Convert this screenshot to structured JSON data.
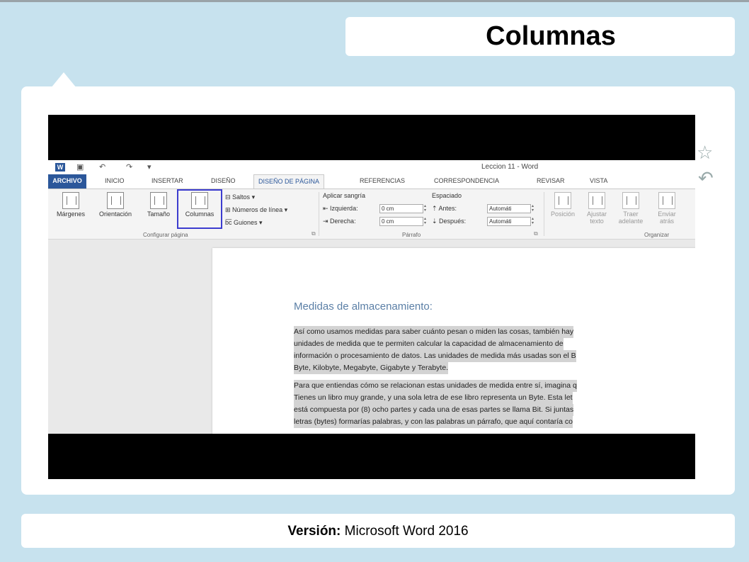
{
  "slide": {
    "title": "Columnas",
    "footer_label": "Versión:",
    "footer_value": " Microsoft Word 2016"
  },
  "word": {
    "doc_title": "Leccion 11 - Word",
    "tabs": [
      "ARCHIVO",
      "INICIO",
      "INSERTAR",
      "DISEÑO",
      "DISEÑO DE PÁGINA",
      "REFERENCIAS",
      "CORRESPONDENCIA",
      "REVISAR",
      "VISTA"
    ],
    "active_tab": "DISEÑO DE PÁGINA",
    "ribbon": {
      "margenes": "Márgenes",
      "orientacion": "Orientación",
      "tamano": "Tamaño",
      "columnas": "Columnas",
      "saltos": "Saltos",
      "numeros_linea": "Números de línea",
      "guiones": "Guiones",
      "group_config": "Configurar página",
      "aplicar_sangria": "Aplicar sangría",
      "izquierda_label": "Izquierda:",
      "izquierda_value": "0 cm",
      "derecha_label": "Derecha:",
      "derecha_value": "0 cm",
      "espaciado": "Espaciado",
      "antes_label": "Antes:",
      "antes_value": "Automáti",
      "despues_label": "Después:",
      "despues_value": "Automáti",
      "group_parrafo": "Párrafo",
      "posicion": "Posición",
      "ajustar_texto": "Ajustar texto",
      "traer_adelante": "Traer adelante",
      "enviar_atras": "Enviar atrás",
      "group_organizar": "Organizar"
    },
    "document": {
      "heading": "Medidas de almacenamiento:",
      "para1": [
        "Así como usamos medidas para saber cuánto pesan o miden las cosas, también hay",
        "unidades de medida que te permiten calcular la capacidad de almacenamiento de",
        "información o procesamiento de datos. Las unidades de medida más usadas son el B",
        "Byte, Kilobyte, Megabyte, Gigabyte y Terabyte."
      ],
      "para2": [
        "Para que entiendas cómo se relacionan estas unidades de medida entre sí, imagina q",
        "Tienes un libro muy grande, y una sola letra de ese libro representa un Byte. Esta let",
        "está compuesta por (8) ocho partes y cada una de esas partes se llama Bit. Si juntas",
        "letras (bytes) formarías palabras, y con las palabras un párrafo, que aquí contaría co"
      ]
    }
  },
  "icons": [
    "star-icon",
    "back-arrow-icon"
  ]
}
